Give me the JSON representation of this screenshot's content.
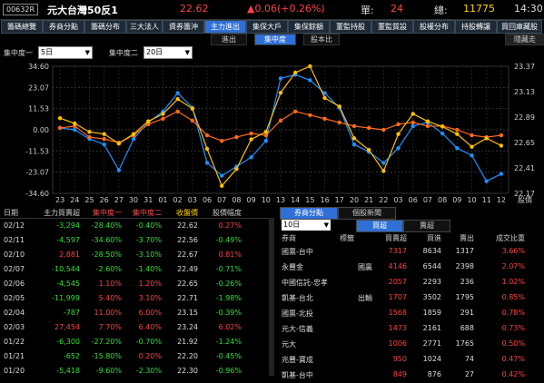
{
  "header": {
    "code": "00632R",
    "name": "元大台灣50反1",
    "price": "22.62",
    "change": "▲0.06(+0.26%)",
    "unit_label": "單:",
    "unit_value": "24",
    "total_label": "總:",
    "total_value": "11775",
    "time": "14:30"
  },
  "tabs": [
    "籌碼總覽",
    "券商分點",
    "籌碼分布",
    "三大法人",
    "資券籌沖",
    "主力進出",
    "集保大戶",
    "集保餘額",
    "董監持股",
    "董監質設",
    "股權分布",
    "持股轉讓",
    "買回庫藏股"
  ],
  "active_tab": 5,
  "subtabs": [
    "進出",
    "集中度",
    "股本比"
  ],
  "active_subtab": 1,
  "right_button": "隱藏走",
  "selectors": {
    "label1": "集中度一",
    "value1": "5日",
    "label2": "集中度二",
    "value2": "20日"
  },
  "colors": {
    "series1": "#1e90ff",
    "series2": "#ff6a1a",
    "price": "#ffc000",
    "up": "#ff4040",
    "down": "#30e030"
  },
  "chart_data": {
    "type": "line",
    "x": [
      "23",
      "24",
      "25",
      "26",
      "27",
      "30",
      "31",
      "01",
      "02",
      "03",
      "06",
      "07",
      "08",
      "09",
      "10",
      "13",
      "14",
      "15",
      "16",
      "17",
      "20",
      "21",
      "22",
      "03",
      "06",
      "07",
      "08",
      "09",
      "10",
      "11",
      "12"
    ],
    "x_tick_labels": [
      "23",
      "24",
      "25",
      "26",
      "27",
      "30",
      "31",
      "01",
      "02",
      "03",
      "06",
      "07",
      "08",
      "09",
      "10",
      "13",
      "14",
      "15",
      "16",
      "17",
      "20",
      "21",
      "22",
      "03",
      "06",
      "07",
      "08",
      "09",
      "10",
      "11",
      "12",
      "股價"
    ],
    "y_left_ticks": [
      "34.60",
      "23.07",
      "11.53",
      "0.00",
      "-11.53",
      "-23.07",
      "-34.60"
    ],
    "y_left_range": [
      -34.6,
      34.6
    ],
    "y_right_ticks": [
      "23.37",
      "23.13",
      "22.89",
      "22.65",
      "22.41",
      "22.17"
    ],
    "y_right_range": [
      22.17,
      23.37
    ],
    "series": [
      {
        "values": [
          1,
          0,
          -5,
          -8,
          -22,
          -5,
          4,
          10,
          20,
          12,
          -18,
          -25,
          -20,
          -15,
          -6,
          28,
          30,
          27,
          20,
          12,
          -8,
          -12,
          -18,
          -10,
          2,
          4,
          -2,
          -10,
          -14,
          -28,
          -24
        ]
      },
      {
        "values": [
          1,
          2,
          -4,
          -5,
          -7,
          -3,
          3,
          6,
          10,
          5,
          -3,
          -6,
          -4,
          -2,
          -3,
          5,
          10,
          8,
          6,
          4,
          2,
          1,
          0,
          3,
          4,
          2,
          2,
          0,
          -3,
          -4,
          -3
        ]
      },
      {
        "values": [
          22.88,
          22.83,
          22.75,
          22.73,
          22.64,
          22.73,
          22.85,
          22.92,
          23.06,
          22.97,
          22.59,
          22.24,
          22.4,
          22.68,
          22.75,
          23.12,
          23.31,
          23.37,
          23.07,
          22.99,
          22.69,
          22.58,
          22.38,
          22.73,
          22.92,
          22.85,
          22.8,
          22.73,
          22.61,
          22.69,
          22.62
        ]
      }
    ]
  },
  "left_table": {
    "headers": [
      "日期",
      "主力買賣超",
      "集中度一",
      "集中度二",
      "收盤價",
      "股價幅度"
    ],
    "rows": [
      [
        "02/12",
        "-3,294",
        "-28.40%",
        "-0.40%",
        "22.62",
        "0.27%"
      ],
      [
        "02/11",
        "-4,597",
        "-34.60%",
        "-3.70%",
        "22.56",
        "-0.49%"
      ],
      [
        "02/10",
        "2,881",
        "-28.50%",
        "-3.10%",
        "22.67",
        "0.81%"
      ],
      [
        "02/07",
        "-10,544",
        "-2.60%",
        "-1.40%",
        "22.49",
        "-0.71%"
      ],
      [
        "02/06",
        "-4,545",
        "1.10%",
        "1.20%",
        "22.65",
        "-0.26%"
      ],
      [
        "02/05",
        "-11,999",
        "5.40%",
        "3.10%",
        "22.71",
        "-1.98%"
      ],
      [
        "02/04",
        "-787",
        "11.00%",
        "6.00%",
        "23.15",
        "-0.39%"
      ],
      [
        "02/03",
        "27,454",
        "7.70%",
        "6.40%",
        "23.24",
        "6.02%"
      ],
      [
        "01/22",
        "-6,300",
        "-27.20%",
        "-0.70%",
        "21.92",
        "-1.24%"
      ],
      [
        "01/21",
        "-652",
        "-15.80%",
        "0.20%",
        "22.20",
        "-0.45%"
      ],
      [
        "01/20",
        "-5,418",
        "-9.60%",
        "-2.30%",
        "22.30",
        "-0.96%"
      ]
    ]
  },
  "right_panel": {
    "tabs": [
      "券商分點",
      "個股新聞"
    ],
    "active_tab": 0,
    "period": "10日",
    "buy_tab": "買超",
    "sell_tab": "賣超",
    "headers": [
      "券商",
      "標籤",
      "買賣超",
      "買進",
      "賣出",
      "成交比重"
    ],
    "rows": [
      [
        "國票-台中",
        "",
        "7317",
        "8634",
        "1317",
        "3.66%"
      ],
      [
        "永豐金",
        "國贏",
        "4146",
        "6544",
        "2398",
        "2.07%"
      ],
      [
        "中國信託-忠孝",
        "",
        "2057",
        "2293",
        "236",
        "1.02%"
      ],
      [
        "凱基-台北",
        "出輸",
        "1707",
        "3502",
        "1795",
        "0.85%"
      ],
      [
        "國票-北投",
        "",
        "1568",
        "1859",
        "291",
        "0.78%"
      ],
      [
        "元大-信義",
        "",
        "1473",
        "2161",
        "688",
        "0.73%"
      ],
      [
        "元大",
        "",
        "1006",
        "2771",
        "1765",
        "0.50%"
      ],
      [
        "兆豐-寶成",
        "",
        "950",
        "1024",
        "74",
        "0.47%"
      ],
      [
        "凱基-台中",
        "",
        "849",
        "876",
        "27",
        "0.42%"
      ]
    ]
  }
}
